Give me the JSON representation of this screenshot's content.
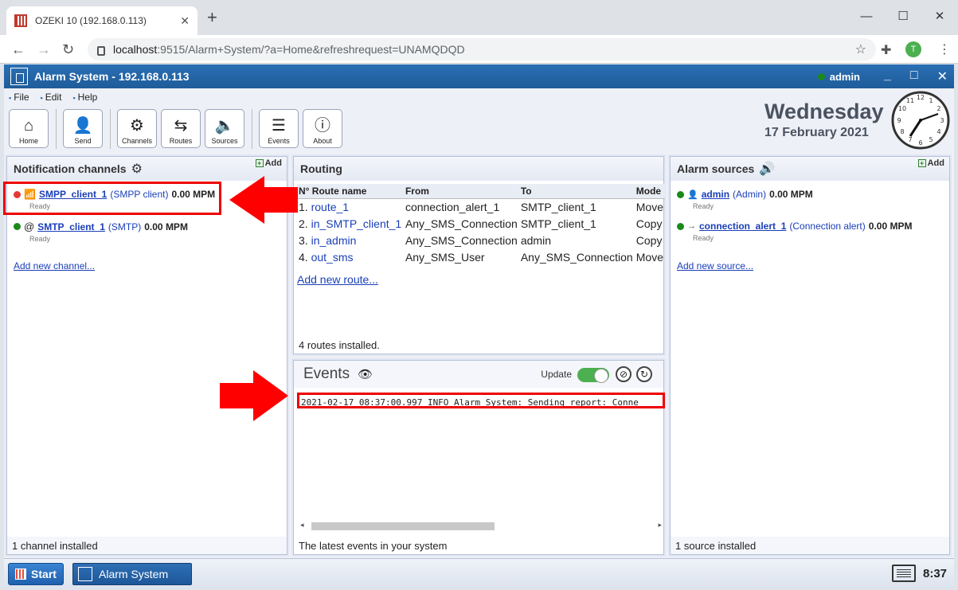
{
  "browser": {
    "tab_title": "OZEKI 10 (192.168.0.113)",
    "url_host": "localhost",
    "url_rest": ":9515/Alarm+System/?a=Home&refreshrequest=UNAMQDQD",
    "profile_initial": "T"
  },
  "app": {
    "title": "Alarm System - 192.168.0.113",
    "user": "admin"
  },
  "menu": [
    "File",
    "Edit",
    "Help"
  ],
  "toolbar": {
    "home": "Home",
    "send": "Send",
    "channels": "Channels",
    "routes": "Routes",
    "sources": "Sources",
    "events": "Events",
    "about": "About"
  },
  "date": {
    "day": "Wednesday",
    "date": "17 February 2021"
  },
  "channels": {
    "title": "Notification channels",
    "add": "Add",
    "items": [
      {
        "name": "SMPP_client_1",
        "type": "SMPP client",
        "mpm": "0.00 MPM",
        "status": "Ready",
        "state_color": "#e53935"
      },
      {
        "name": "SMTP_client_1",
        "type": "SMTP",
        "mpm": "0.00 MPM",
        "status": "Ready",
        "state_color": "#1b8a1b"
      }
    ],
    "add_new": "Add new channel...",
    "footer": "1 channel installed"
  },
  "routing": {
    "title": "Routing",
    "columns": [
      "N° Route name",
      "From",
      "To",
      "Mode"
    ],
    "rows": [
      {
        "num": "1.",
        "name": "route_1",
        "from": "connection_alert_1",
        "to": "SMTP_client_1",
        "mode": "Move"
      },
      {
        "num": "2.",
        "name": "in_SMTP_client_1",
        "from": "Any_SMS_Connection",
        "to": "SMTP_client_1",
        "mode": "Copy"
      },
      {
        "num": "3.",
        "name": "in_admin",
        "from": "Any_SMS_Connection",
        "to": "admin",
        "mode": "Copy"
      },
      {
        "num": "4.",
        "name": "out_sms",
        "from": "Any_SMS_User",
        "to": "Any_SMS_Connection",
        "mode": "Move"
      }
    ],
    "add_new": "Add new route...",
    "footer": "4 routes installed."
  },
  "events": {
    "title": "Events",
    "update_label": "Update",
    "log_line": "2021-02-17 08:37:00.997 INFO Alarm_System: Sending report: Conne",
    "footer": "The latest events in your system"
  },
  "sources": {
    "title": "Alarm sources",
    "add": "Add",
    "items": [
      {
        "name": "admin",
        "type": "Admin",
        "mpm": "0.00 MPM",
        "status": "Ready"
      },
      {
        "name": "connection_alert_1",
        "type": "Connection alert",
        "mpm": "0.00 MPM",
        "status": "Ready"
      }
    ],
    "add_new": "Add new source...",
    "footer": "1 source installed"
  },
  "taskbar": {
    "start": "Start",
    "task": "Alarm System",
    "time": "8:37"
  },
  "colors": {
    "accent": "#2a6fb4",
    "highlight": "#e00000",
    "link": "#1a3fb8"
  }
}
